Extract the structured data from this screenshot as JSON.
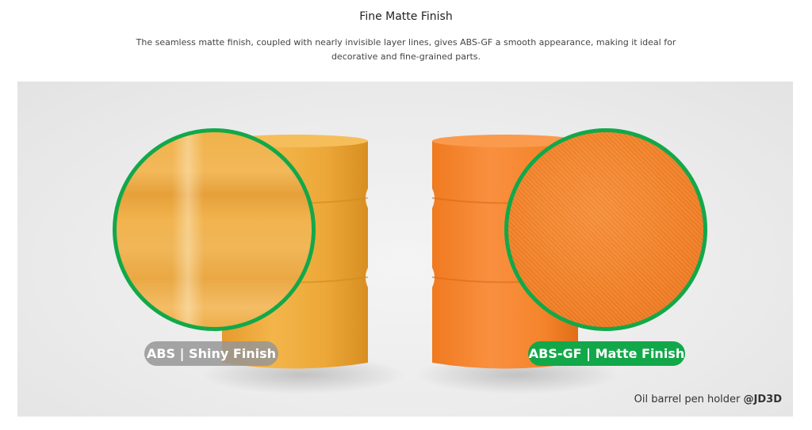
{
  "section": {
    "title": "Fine Matte Finish",
    "description": "The seamless matte finish, coupled with nearly invisible layer lines, gives ABS-GF a smooth appearance, making it ideal for decorative and fine-grained parts."
  },
  "comparison": {
    "left_label": "ABS | Shiny Finish",
    "right_label": "ABS-GF | Matte Finish",
    "credit_prefix": "Oil barrel pen holder ",
    "credit_handle": "@JD3D"
  },
  "colors": {
    "accent_green": "#12a84a",
    "abs_barrel": "#eeaa3a",
    "absgf_barrel": "#f6852a",
    "abs_pill": "#969696"
  }
}
